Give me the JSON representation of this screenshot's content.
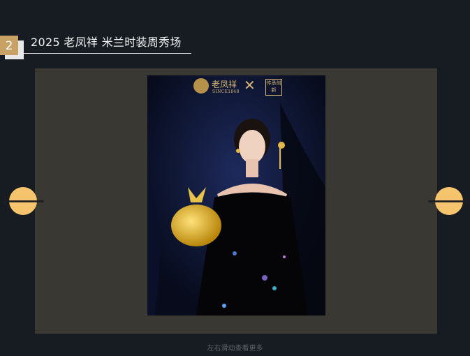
{
  "section": {
    "number": "2",
    "title": "2025 老凤祥 米兰时装周秀场"
  },
  "slide": {
    "brand_name": "老凤祥",
    "brand_since": "SINCE1848",
    "brand_cross": "✕",
    "collab_seal": "传承创新"
  },
  "nav": {
    "prev_icon": "arrow-left-icon",
    "next_icon": "arrow-right-icon",
    "prev_glyph": "🡐",
    "next_glyph": "🡒"
  },
  "hint": "左右滑动查看更多",
  "colors": {
    "background": "#171c22",
    "accent": "#c8a265",
    "arrow": "#f5c46c",
    "panel": "#3a3832"
  }
}
